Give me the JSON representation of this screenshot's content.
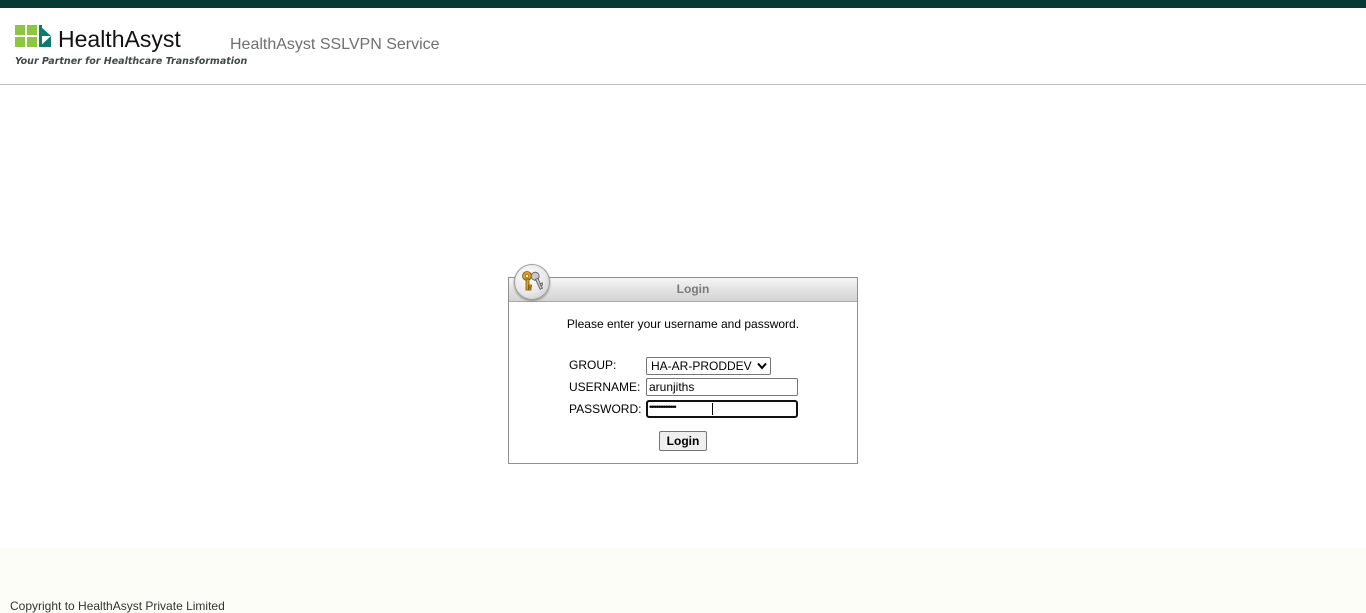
{
  "header": {
    "logo": {
      "name": "HealthAsyst",
      "tagline": "Your Partner for Healthcare Transformation",
      "colors": [
        "#8dc63f",
        "#0e7a6e"
      ]
    },
    "service_title": "HealthAsyst SSLVPN Service"
  },
  "login": {
    "title": "Login",
    "icon": "keys-icon",
    "instructions": "Please enter your username and password.",
    "group_label": "GROUP:",
    "group_value": "HA-AR-PRODDEV",
    "username_label": "USERNAME:",
    "username_value": "arunjiths",
    "password_label": "PASSWORD:",
    "password_masked": "•••••••••••••••",
    "button_label": "Login"
  },
  "footer": {
    "copyright": "Copyright to HealthAsyst Private Limited"
  },
  "colors": {
    "topbar": "#063a34",
    "accent_green": "#8dc63f",
    "accent_teal": "#0e7a6e"
  }
}
